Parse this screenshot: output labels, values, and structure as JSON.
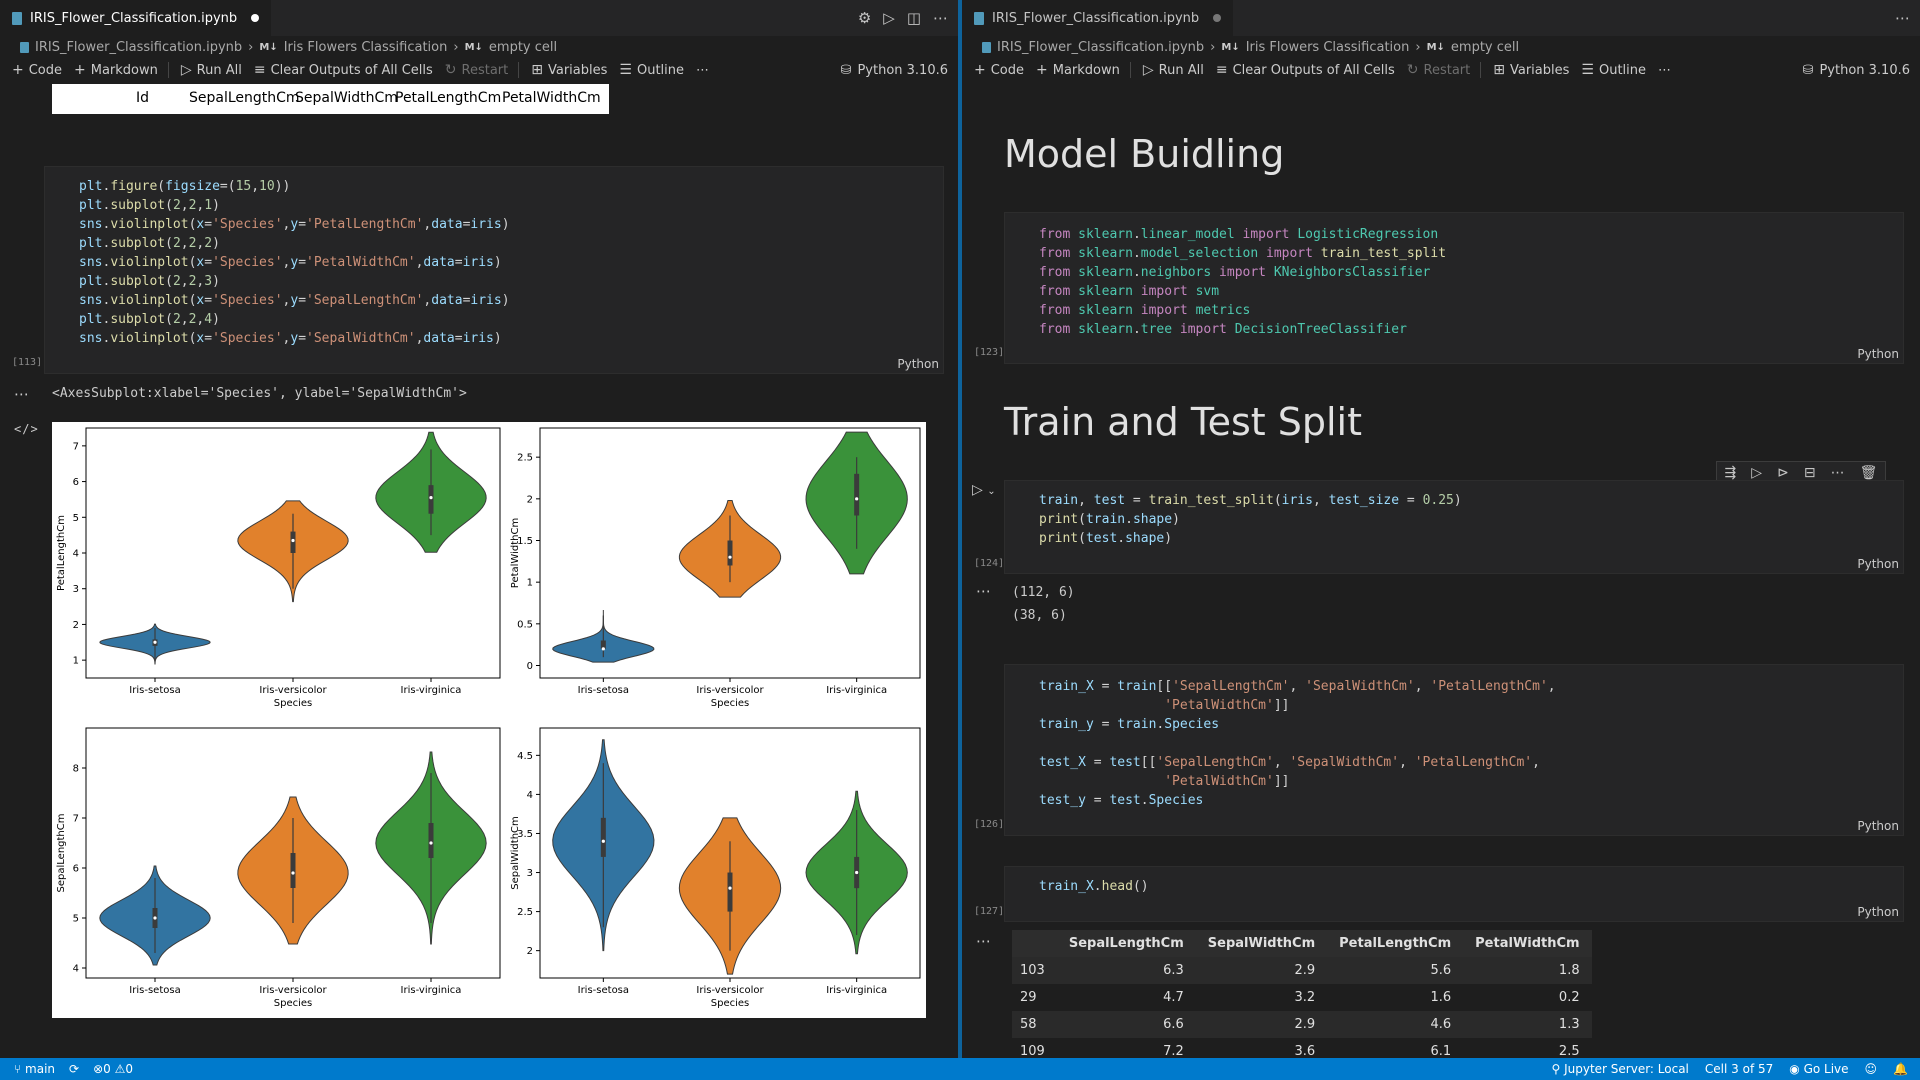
{
  "left": {
    "tab_title": "IRIS_Flower_Classification.ipynb",
    "breadcrumb": [
      "IRIS_Flower_Classification.ipynb",
      "Iris Flowers Classification",
      "empty cell"
    ],
    "toolbar": {
      "code": "Code",
      "markdown": "Markdown",
      "run_all": "Run All",
      "clear_outputs": "Clear Outputs of All Cells",
      "restart": "Restart",
      "variables": "Variables",
      "outline": "Outline",
      "kernel": "Python 3.10.6"
    },
    "table_headers": [
      "Id",
      "SepalLengthCm",
      "SepalWidthCm",
      "PetalLengthCm",
      "PetalWidthCm"
    ],
    "cell113": {
      "count": "[113]",
      "lang": "Python"
    },
    "output_text": "<AxesSubplot:xlabel='Species', ylabel='SepalWidthCm'>"
  },
  "right": {
    "tab_title": "IRIS_Flower_Classification.ipynb",
    "breadcrumb": [
      "IRIS_Flower_Classification.ipynb",
      "Iris Flowers Classification",
      "empty cell"
    ],
    "toolbar": {
      "code": "Code",
      "markdown": "Markdown",
      "run_all": "Run All",
      "clear_outputs": "Clear Outputs of All Cells",
      "restart": "Restart",
      "variables": "Variables",
      "outline": "Outline",
      "kernel": "Python 3.10.6"
    },
    "heading_model": "Model Buidling",
    "heading_split": "Train and Test Split",
    "cell123": {
      "count": "[123]",
      "lang": "Python"
    },
    "cell124": {
      "count": "[124]",
      "lang": "Python",
      "output": [
        "(112, 6)",
        "(38, 6)"
      ]
    },
    "cell126": {
      "count": "[126]",
      "lang": "Python"
    },
    "cell127": {
      "count": "[127]",
      "lang": "Python"
    },
    "df": {
      "columns": [
        "",
        "SepalLengthCm",
        "SepalWidthCm",
        "PetalLengthCm",
        "PetalWidthCm"
      ],
      "rows": [
        [
          "103",
          "6.3",
          "2.9",
          "5.6",
          "1.8"
        ],
        [
          "29",
          "4.7",
          "3.2",
          "1.6",
          "0.2"
        ],
        [
          "58",
          "6.6",
          "2.9",
          "4.6",
          "1.3"
        ],
        [
          "109",
          "7.2",
          "3.6",
          "6.1",
          "2.5"
        ]
      ]
    }
  },
  "statusbar": {
    "branch": "main",
    "problems": "0",
    "warnings": "0",
    "jupyter": "Jupyter Server: Local",
    "cell_pos": "Cell 3 of 57",
    "go_live": "Go Live"
  },
  "chart_data": [
    {
      "type": "violin",
      "categories": [
        "Iris-setosa",
        "Iris-versicolor",
        "Iris-virginica"
      ],
      "xlabel": "Species",
      "ylabel": "PetalLengthCm",
      "yticks": [
        1,
        2,
        3,
        4,
        5,
        6,
        7
      ],
      "ylim": [
        0.5,
        7.5
      ],
      "series": [
        {
          "min": 1.0,
          "q1": 1.4,
          "median": 1.5,
          "q3": 1.58,
          "max": 1.9
        },
        {
          "min": 3.0,
          "q1": 4.0,
          "median": 4.35,
          "q3": 4.6,
          "max": 5.1
        },
        {
          "min": 4.5,
          "q1": 5.1,
          "median": 5.55,
          "q3": 5.9,
          "max": 6.9
        }
      ],
      "colors": [
        "#3274a1",
        "#e1812c",
        "#3a923a"
      ]
    },
    {
      "type": "violin",
      "categories": [
        "Iris-setosa",
        "Iris-versicolor",
        "Iris-virginica"
      ],
      "xlabel": "Species",
      "ylabel": "PetalWidthCm",
      "yticks": [
        0.0,
        0.5,
        1.0,
        1.5,
        2.0,
        2.5
      ],
      "ylim": [
        -0.15,
        2.85
      ],
      "series": [
        {
          "min": 0.1,
          "q1": 0.2,
          "median": 0.2,
          "q3": 0.3,
          "max": 0.6
        },
        {
          "min": 1.0,
          "q1": 1.2,
          "median": 1.3,
          "q3": 1.5,
          "max": 1.8
        },
        {
          "min": 1.4,
          "q1": 1.8,
          "median": 2.0,
          "q3": 2.3,
          "max": 2.5
        }
      ],
      "colors": [
        "#3274a1",
        "#e1812c",
        "#3a923a"
      ]
    },
    {
      "type": "violin",
      "categories": [
        "Iris-setosa",
        "Iris-versicolor",
        "Iris-virginica"
      ],
      "xlabel": "Species",
      "ylabel": "SepalLengthCm",
      "yticks": [
        4,
        5,
        6,
        7,
        8
      ],
      "ylim": [
        3.8,
        8.8
      ],
      "series": [
        {
          "min": 4.3,
          "q1": 4.8,
          "median": 5.0,
          "q3": 5.2,
          "max": 5.8
        },
        {
          "min": 4.9,
          "q1": 5.6,
          "median": 5.9,
          "q3": 6.3,
          "max": 7.0
        },
        {
          "min": 4.9,
          "q1": 6.2,
          "median": 6.5,
          "q3": 6.9,
          "max": 7.9
        }
      ],
      "colors": [
        "#3274a1",
        "#e1812c",
        "#3a923a"
      ]
    },
    {
      "type": "violin",
      "categories": [
        "Iris-setosa",
        "Iris-versicolor",
        "Iris-virginica"
      ],
      "xlabel": "Species",
      "ylabel": "SepalWidthCm",
      "yticks": [
        2.0,
        2.5,
        3.0,
        3.5,
        4.0,
        4.5
      ],
      "ylim": [
        1.65,
        4.85
      ],
      "series": [
        {
          "min": 2.3,
          "q1": 3.2,
          "median": 3.4,
          "q3": 3.7,
          "max": 4.4
        },
        {
          "min": 2.0,
          "q1": 2.5,
          "median": 2.8,
          "q3": 3.0,
          "max": 3.4
        },
        {
          "min": 2.2,
          "q1": 2.8,
          "median": 3.0,
          "q3": 3.2,
          "max": 3.8
        }
      ],
      "colors": [
        "#3274a1",
        "#e1812c",
        "#3a923a"
      ]
    }
  ]
}
